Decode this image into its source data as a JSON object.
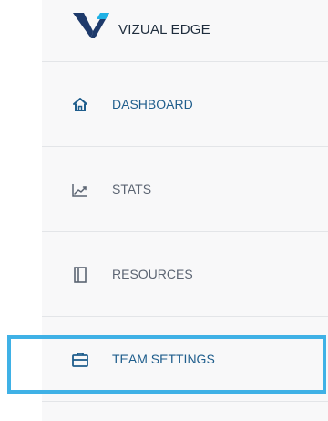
{
  "brand": {
    "name": "VIZUAL EDGE",
    "logo_icon": "vizual-edge-v-logo",
    "colors": {
      "primary": "#1e3a6b",
      "accent": "#1fb1e5"
    }
  },
  "nav": {
    "items": [
      {
        "label": "DASHBOARD",
        "icon": "home-icon"
      },
      {
        "label": "STATS",
        "icon": "chart-line-icon"
      },
      {
        "label": "RESOURCES",
        "icon": "book-icon"
      },
      {
        "label": "TEAM SETTINGS",
        "icon": "briefcase-icon"
      }
    ]
  },
  "colors": {
    "highlight": "#3fb1e6",
    "active_text": "#1e5d8c",
    "inactive_text": "#5b6472"
  }
}
